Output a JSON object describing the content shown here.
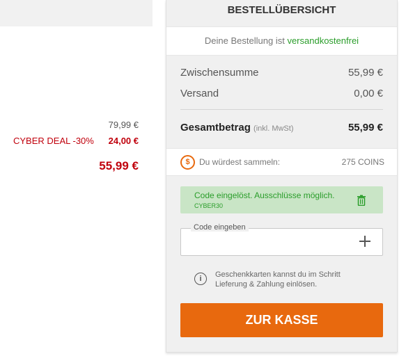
{
  "product": {
    "original_price": "79,99 €",
    "deal_label": "CYBER DEAL -30%",
    "deal_value": "24,00 €",
    "final_price": "55,99 €"
  },
  "summary": {
    "title": "BESTELLÜBERSICHT",
    "shipping_notice_prefix": "Deine Bestellung ist",
    "shipping_notice_highlight": "versandkostenfrei",
    "subtotal_label": "Zwischensumme",
    "subtotal_value": "55,99 €",
    "shipping_label": "Versand",
    "shipping_value": "0,00 €",
    "total_label": "Gesamtbetrag",
    "total_note": "(inkl. MwSt)",
    "total_value": "55,99 €"
  },
  "coins": {
    "label": "Du würdest sammeln:",
    "value": "275 COINS"
  },
  "coupon": {
    "message": "Code eingelöst. Ausschlüsse möglich.",
    "code": "CYBER30"
  },
  "code_input": {
    "legend": "Code eingeben",
    "value": "",
    "placeholder": ""
  },
  "info": {
    "line1": "Geschenkkarten kannst du im Schritt",
    "line2": "Lieferung & Zahlung einlösen."
  },
  "checkout": {
    "label": "ZUR KASSE"
  },
  "colors": {
    "accent": "#e8690e",
    "deal_red": "#c0000c",
    "success_green": "#2a9d2a",
    "coupon_bg": "#c9e5c6"
  }
}
